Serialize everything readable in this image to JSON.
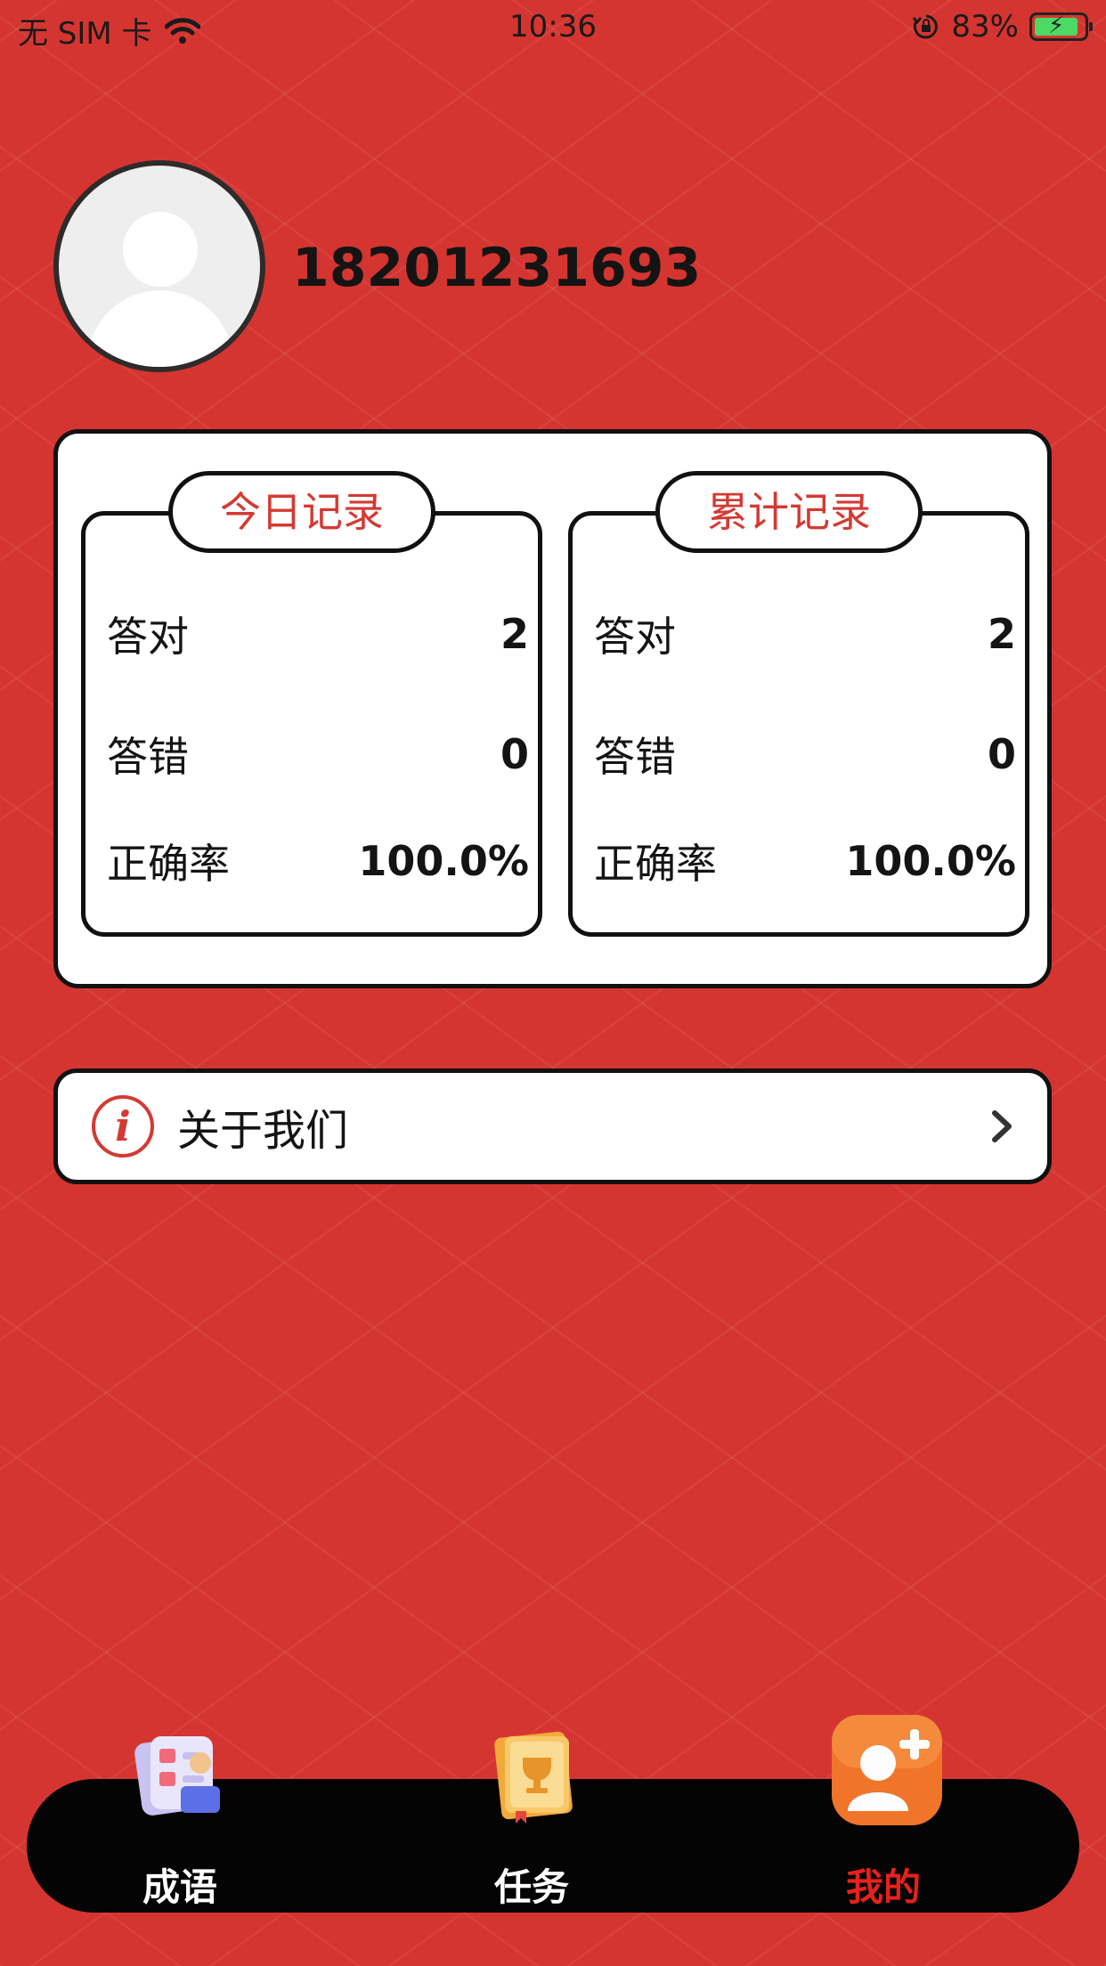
{
  "status_bar": {
    "carrier": "无 SIM 卡",
    "time": "10:36",
    "battery": "83%"
  },
  "profile": {
    "username": "18201231693"
  },
  "today_record": {
    "title": "今日记录",
    "rows": [
      {
        "label": "答对",
        "value": "2"
      },
      {
        "label": "答错",
        "value": "0"
      },
      {
        "label": "正确率",
        "value": "100.0%"
      }
    ]
  },
  "total_record": {
    "title": "累计记录",
    "rows": [
      {
        "label": "答对",
        "value": "2"
      },
      {
        "label": "答错",
        "value": "0"
      },
      {
        "label": "正确率",
        "value": "100.0%"
      }
    ]
  },
  "about": {
    "label": "关于我们",
    "icon_glyph": "i"
  },
  "tabs": [
    {
      "label": "成语",
      "icon": "idiom-cards-icon"
    },
    {
      "label": "任务",
      "icon": "trophy-book-icon"
    },
    {
      "label": "我的",
      "icon": "add-user-icon",
      "active": true
    }
  ],
  "colors": {
    "background": "#d53530",
    "accent": "#d33a33",
    "active_tab": "#e8201c",
    "tab_bar": "#040404"
  }
}
